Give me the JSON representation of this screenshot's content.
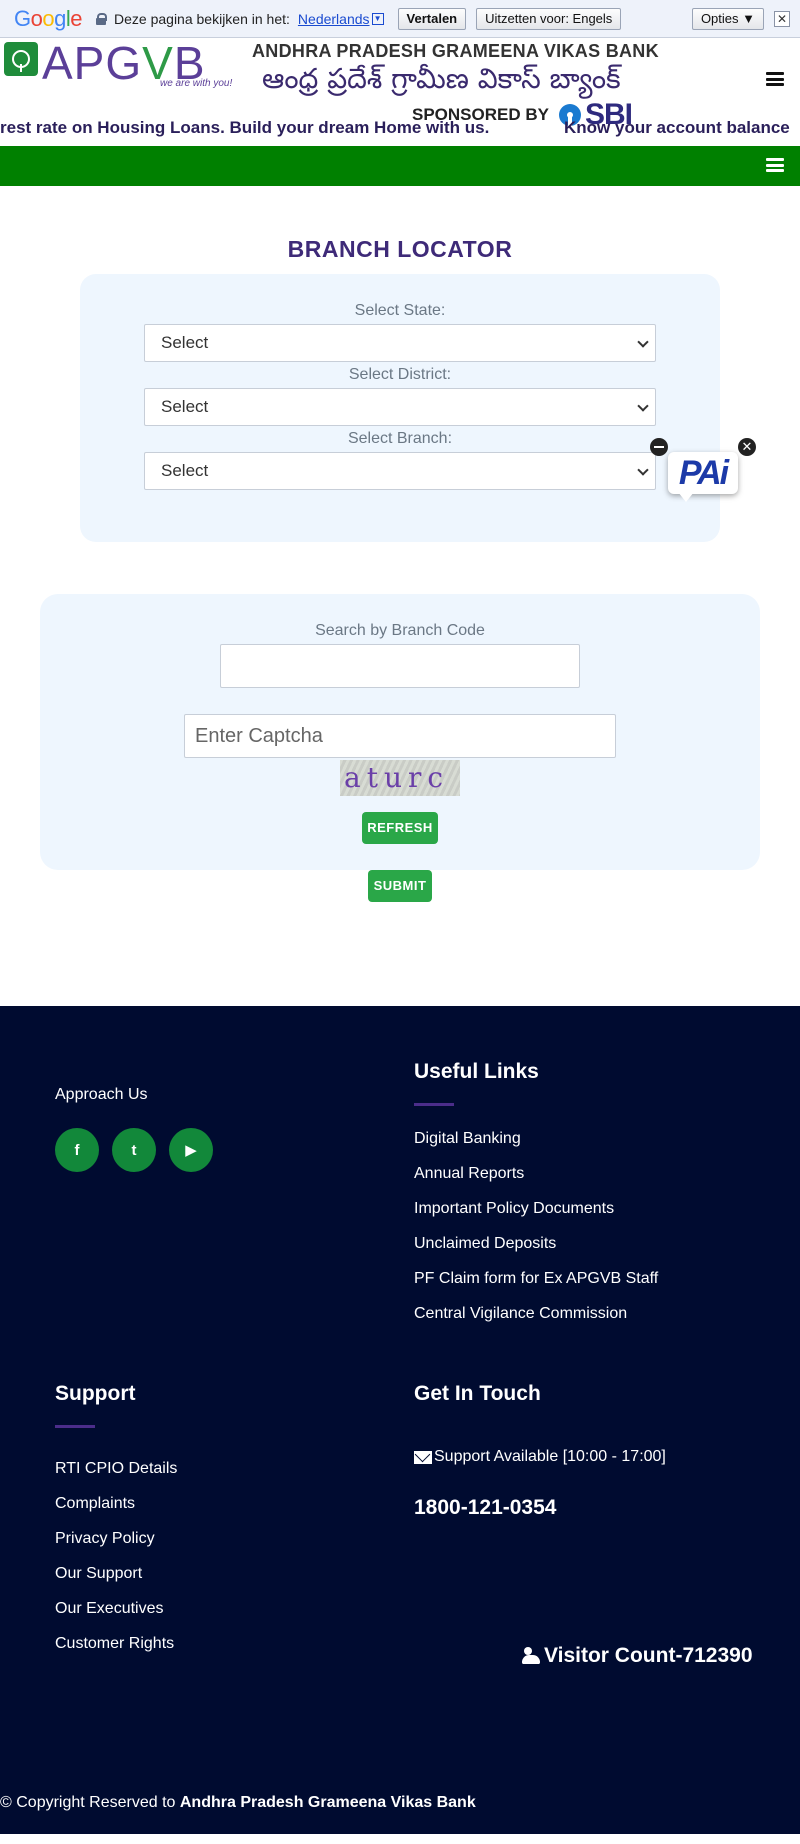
{
  "translate_bar": {
    "logo": "Google",
    "prompt": "Deze pagina bekijken in het:",
    "language": "Nederlands",
    "translate_button": "Vertalen",
    "disable_button": "Uitzetten voor: Engels",
    "options_button": "Opties ▼",
    "close": "✕"
  },
  "header": {
    "brand": "APGVB",
    "tagline": "we are with you!",
    "bank_name_en": "ANDHRA PRADESH GRAMEENA VIKAS BANK",
    "bank_name_te": "ఆంధ్ర ప్రదేశ్ గ్రామీణ వికాస్ బ్యాంక్",
    "sponsored_by": "SPONSORED BY",
    "sponsor": "SBI",
    "marquee_1": "rest rate on Housing Loans. Build your dream Home with us.",
    "marquee_2": "Know your account balance"
  },
  "main": {
    "title": "BRANCH LOCATOR",
    "state_label": "Select State:",
    "state_value": "Select",
    "district_label": "Select District:",
    "district_value": "Select",
    "branch_label": "Select Branch:",
    "branch_value": "Select",
    "branch_code_label": "Search by Branch Code",
    "branch_code_value": "",
    "captcha_placeholder": "Enter Captcha",
    "captcha_text": "aturc",
    "refresh_label": "REFRESH",
    "submit_label": "SUBMIT"
  },
  "chat_widget": {
    "label": "PAi"
  },
  "footer": {
    "approach_us": "Approach Us",
    "social": [
      "f",
      "t",
      "▶"
    ],
    "useful_links_title": "Useful Links",
    "useful_links": [
      "Digital Banking",
      "Annual Reports",
      "Important Policy Documents",
      "Unclaimed Deposits",
      "PF Claim form for Ex APGVB Staff",
      "Central Vigilance Commission"
    ],
    "support_title": "Support",
    "support_links": [
      "RTI CPIO Details",
      "Complaints",
      "Privacy Policy",
      "Our Support",
      "Our Executives",
      "Customer Rights"
    ],
    "contact_title": "Get In Touch",
    "support_hours": "Support Available [10:00 - 17:00]",
    "phone": "1800-121-0354",
    "visitor_count": "Visitor Count-712390",
    "copyright_prefix": "© Copyright Reserved to ",
    "copyright_name": "Andhra Pradesh Grameena Vikas Bank"
  }
}
